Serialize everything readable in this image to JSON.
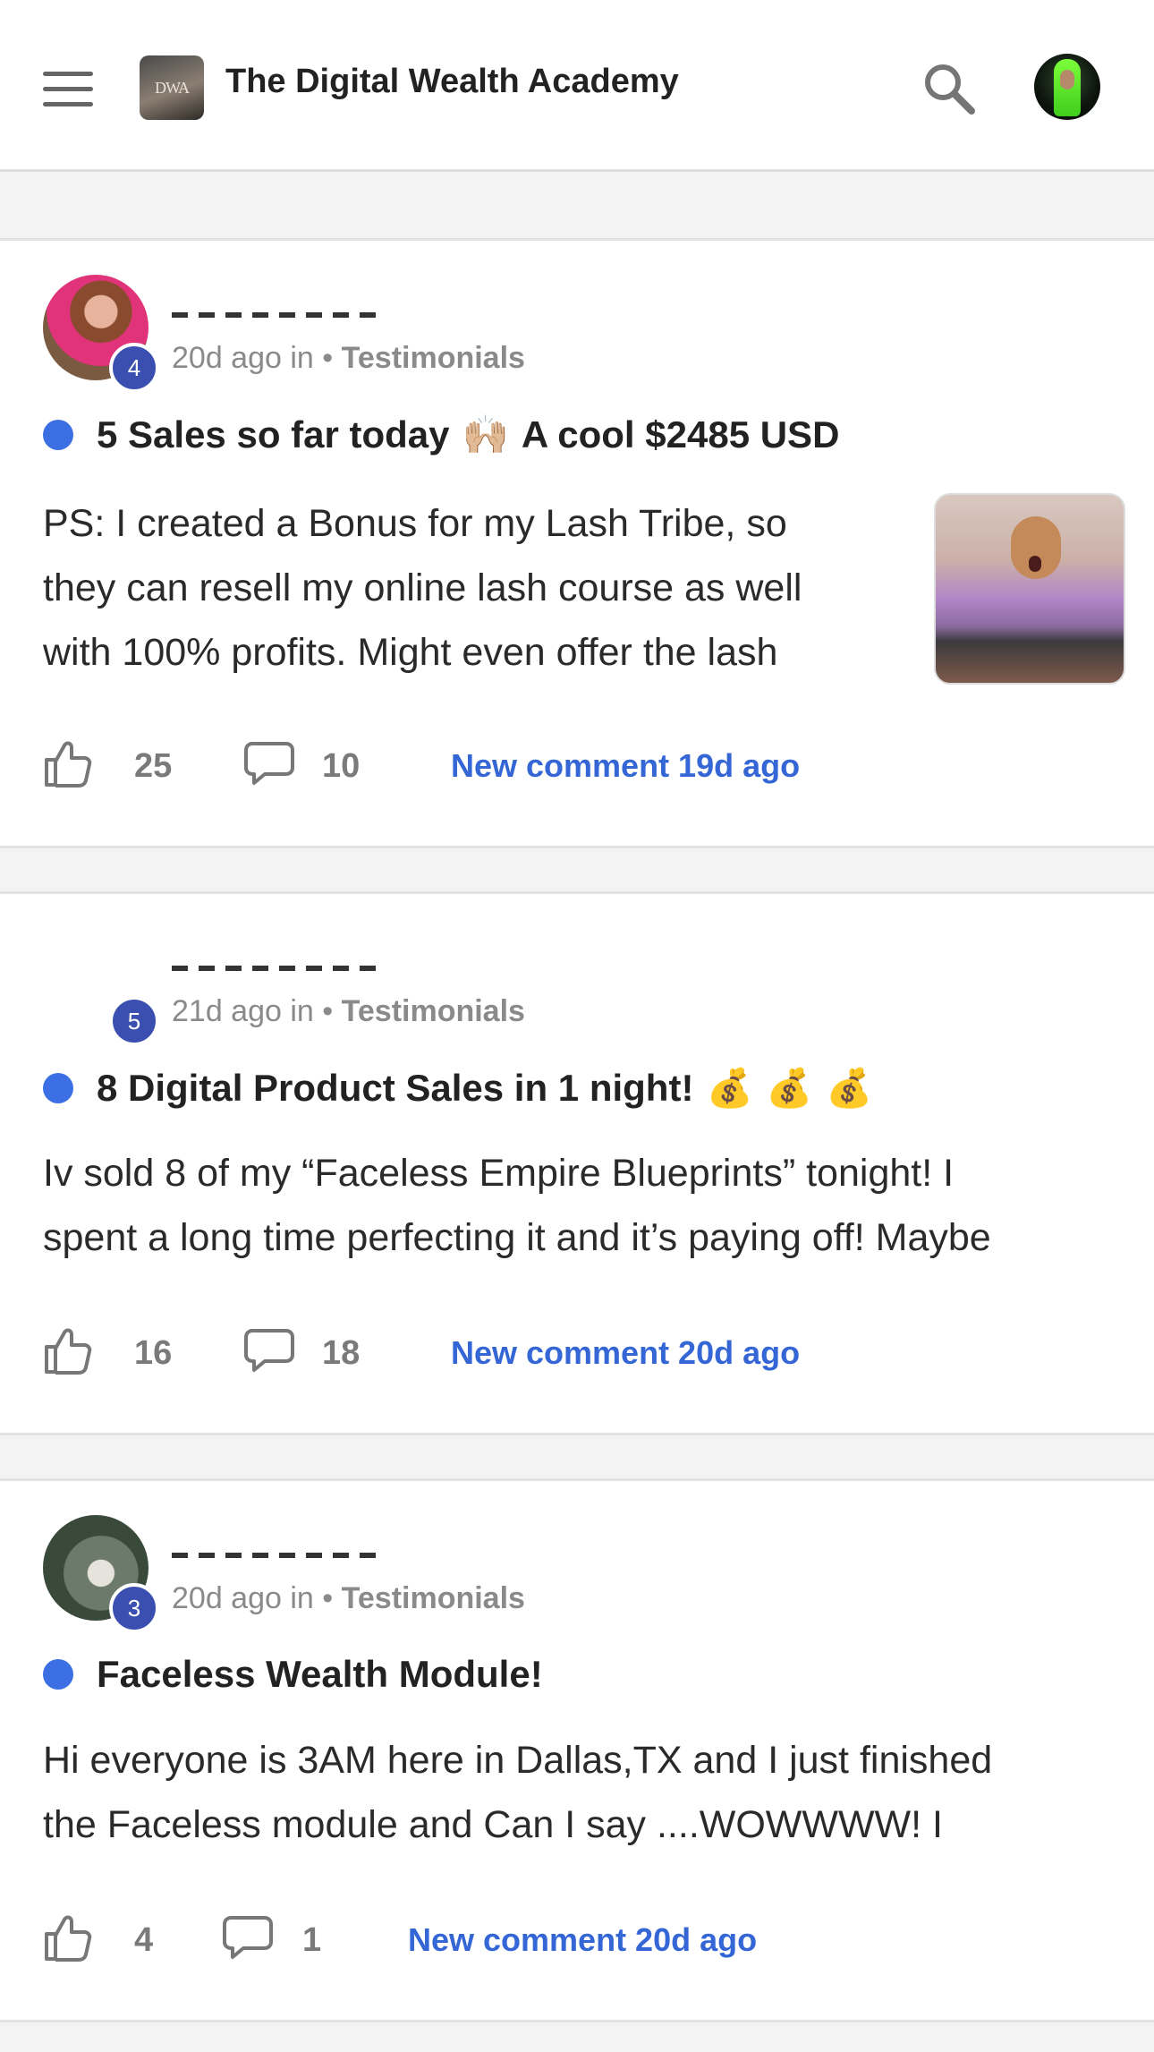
{
  "header": {
    "title": "The Digital Wealth Academy",
    "logo_text": "DWA",
    "menu_icon": "hamburger-menu-icon",
    "search_icon": "search-icon"
  },
  "posts": [
    {
      "level": "4",
      "time": "20d ago in",
      "category": "Testimonials",
      "title": "5 Sales so far today",
      "title_emoji": "🙌🏼",
      "title_suffix": "A cool $2485 USD",
      "body_lines": [
        "PS: I created a Bonus for my Lash Tribe, so",
        "they can resell my online lash course as well",
        "with 100% profits. Might even offer the lash"
      ],
      "likes": "25",
      "comments": "10",
      "new_comment": "New comment 19d ago"
    },
    {
      "level": "5",
      "time": "21d ago in",
      "category": "Testimonials",
      "title": "8 Digital Product Sales in 1 night!",
      "title_emoji": "💰 💰 💰",
      "body_lines": [
        "Iv sold 8 of my “Faceless Empire Blueprints” tonight! I",
        "spent a long time perfecting it and it’s paying off! Maybe"
      ],
      "likes": "16",
      "comments": "18",
      "new_comment": "New comment 20d ago"
    },
    {
      "level": "3",
      "time": "20d ago in",
      "category": "Testimonials",
      "title": "Faceless Wealth Module!",
      "body_lines": [
        "Hi everyone is 3AM here in Dallas,TX and I just finished",
        "the Faceless module and Can I say ....WOWWWW! I"
      ],
      "likes": "4",
      "comments": "1",
      "new_comment": "New comment 20d ago"
    }
  ],
  "colors": {
    "accent_blue": "#3466d6",
    "unread_dot": "#3b6fe3",
    "level_badge": "#3a4fb0"
  }
}
